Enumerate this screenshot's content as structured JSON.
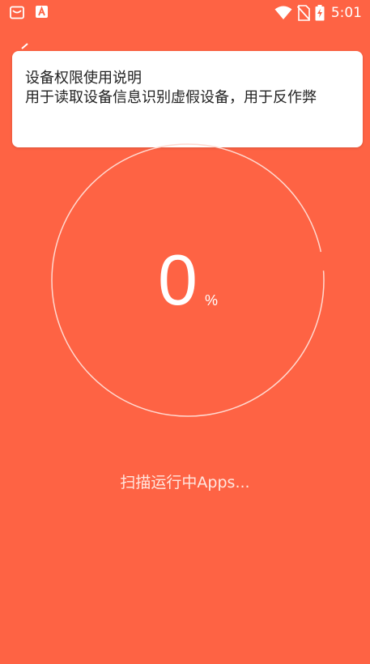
{
  "status_bar": {
    "time": "5:01",
    "icons": [
      "notification-icon",
      "app-a-icon",
      "wifi-icon",
      "no-sim-icon",
      "battery-charging-icon"
    ]
  },
  "permission_dialog": {
    "title": "设备权限使用说明",
    "body": "用于读取设备信息识别虚假设备，用于反作弊"
  },
  "progress": {
    "value": "0",
    "unit": "%",
    "fraction": 0
  },
  "scan_status": "扫描运行中Apps...",
  "colors": {
    "background": "#fe6344",
    "ring": "#ffd9d0",
    "card": "#ffffff",
    "text_dark": "#222222"
  }
}
